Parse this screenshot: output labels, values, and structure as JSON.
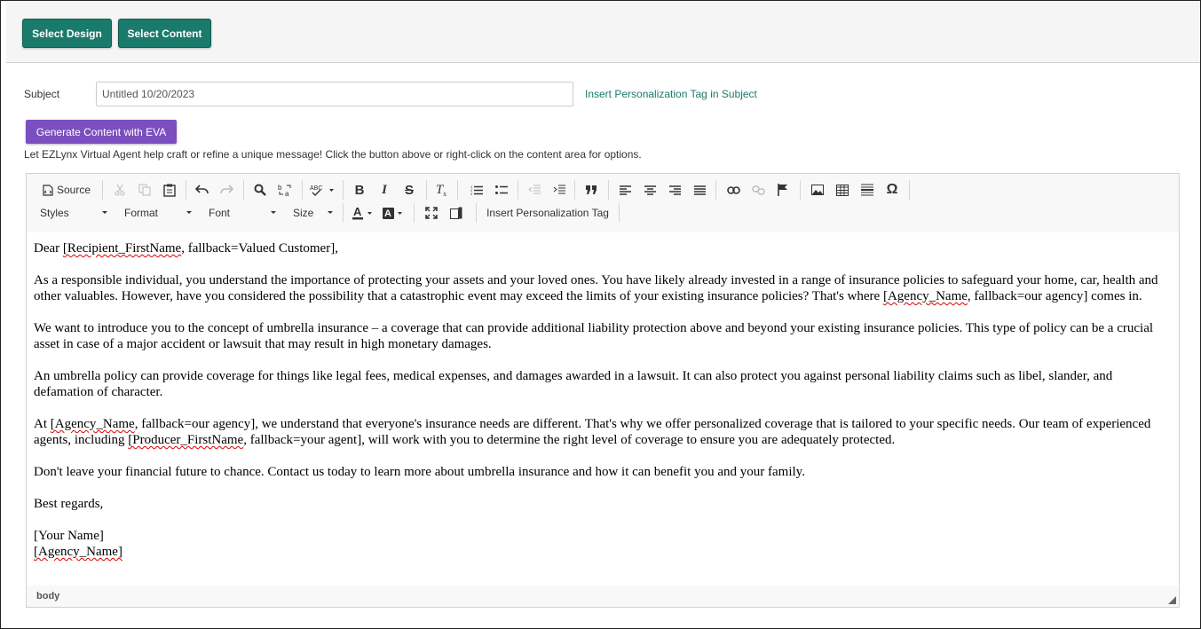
{
  "top": {
    "select_design": "Select Design",
    "select_content": "Select Content"
  },
  "subject": {
    "label": "Subject",
    "value": "Untitled 10/20/2023",
    "insert_tag_link": "Insert Personalization Tag in Subject"
  },
  "eva": {
    "button": "Generate Content with EVA",
    "help_text": "Let EZLynx Virtual Agent help craft or refine a unique message! Click the button above or right-click on the content area for options."
  },
  "toolbar": {
    "source": "Source",
    "combos": {
      "styles": "Styles",
      "format": "Format",
      "font": "Font",
      "size": "Size"
    },
    "insert_tag": "Insert Personalization Tag"
  },
  "body": {
    "greeting_prefix": "Dear ",
    "greeting_tag": "[Recipient_FirstName",
    "greeting_suffix": ", fallback=Valued Customer],",
    "p1_start": "As a responsible individual, you understand the importance of protecting your assets and your loved ones. You have likely already invested in a range of insurance policies to safeguard your home, car, health and other valuables. However, have you considered the possibility that a catastrophic event may exceed the limits of your existing insurance policies? That's where ",
    "p1_tag": "[Agency_Name",
    "p1_end": ", fallback=our agency] comes in.",
    "p2": "We want to introduce you to the concept of umbrella insurance – a coverage that can provide additional liability protection above and beyond your existing insurance policies. This type of policy can be a crucial asset in case of a major accident or lawsuit that may result in high monetary damages.",
    "p3": "An umbrella policy can provide coverage for things like legal fees, medical expenses, and damages awarded in a lawsuit. It can also protect you against personal liability claims such as libel, slander, and defamation of character.",
    "p4_start": "At ",
    "p4_tag1": "[Agency_Name",
    "p4_mid": ", fallback=our agency], we understand that everyone's insurance needs are different. That's why we offer personalized coverage that is tailored to your specific needs. Our team of experienced agents, including ",
    "p4_tag2": "[Producer_FirstName",
    "p4_end": ", fallback=your agent], will work with you to determine the right level of coverage to ensure you are adequately protected.",
    "p5": "Don't leave your financial future to chance. Contact us today to learn more about umbrella insurance and how it can benefit you and your family.",
    "closing": "Best regards,",
    "sig1": "[Your Name]",
    "sig2": "[Agency_Name]"
  },
  "elements_path": "body"
}
